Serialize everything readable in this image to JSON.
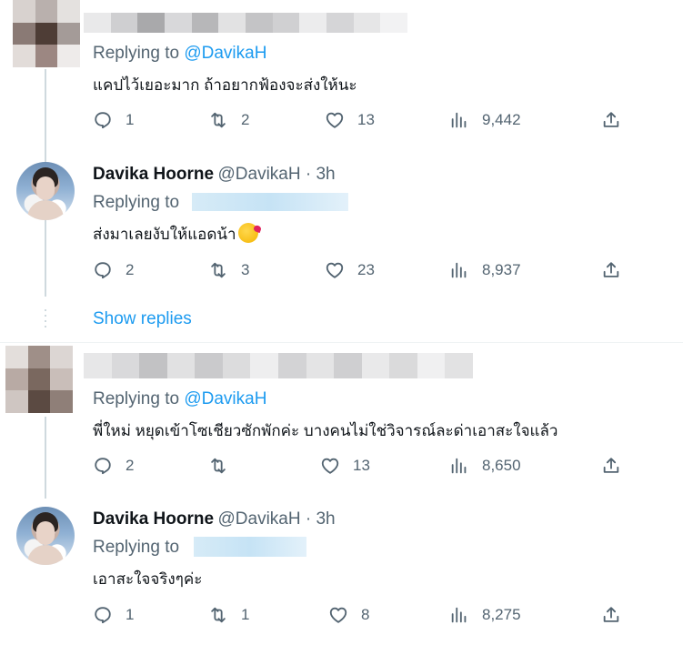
{
  "tweets": [
    {
      "reply_prefix": "Replying to ",
      "reply_to": "@DavikaH",
      "text": "แคปไว้เยอะมาก ถ้าอยากฟ้องจะส่งให้นะ",
      "stats": {
        "replies": "1",
        "retweets": "2",
        "likes": "13",
        "views": "9,442"
      }
    },
    {
      "name": "Davika Hoorne",
      "handle_time": "@DavikaH · 3h",
      "reply_prefix": "Replying to ",
      "text": "ส่งมาเลยงับให้แอดน้า",
      "stats": {
        "replies": "2",
        "retweets": "3",
        "likes": "23",
        "views": "8,937"
      }
    },
    {
      "reply_prefix": "Replying to ",
      "reply_to": "@DavikaH",
      "text": "พี่ใหม่ หยุดเข้าโซเชียวซักพักค่ะ บางคนไม่ใช่วิจารณ์ละด่าเอาสะใจแล้ว",
      "stats": {
        "replies": "2",
        "retweets": "",
        "likes": "13",
        "views": "8,650"
      }
    },
    {
      "name": "Davika Hoorne",
      "handle_time": "@DavikaH · 3h",
      "reply_prefix": "Replying to ",
      "text": "เอาสะใจจริงๆค่ะ",
      "stats": {
        "replies": "1",
        "retweets": "1",
        "likes": "8",
        "views": "8,275"
      }
    }
  ],
  "show_replies": "Show replies",
  "icons": {
    "reply": "reply-icon",
    "retweet": "retweet-icon",
    "like": "heart-icon",
    "views": "views-icon",
    "share": "share-icon"
  },
  "colors": {
    "link": "#1d9bf0",
    "secondary": "#536471",
    "text": "#0f1419"
  }
}
